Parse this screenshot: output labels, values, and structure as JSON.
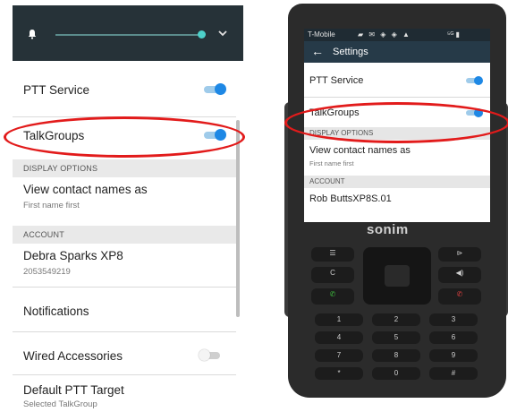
{
  "left_panel": {
    "settings": [
      {
        "title": "PTT Service",
        "toggle": "on"
      },
      {
        "title": "TalkGroups",
        "toggle": "on"
      }
    ],
    "section_display": "DISPLAY OPTIONS",
    "view_contact": {
      "title": "View contact names as",
      "subtitle": "First name first"
    },
    "section_account": "ACCOUNT",
    "account": {
      "name": "Debra Sparks XP8",
      "number": "2053549219"
    },
    "notifications": "Notifications",
    "wired_accessories": {
      "title": "Wired Accessories",
      "toggle": "off"
    },
    "default_ptt": {
      "title": "Default PTT Target",
      "subtitle": "Selected TalkGroup"
    }
  },
  "right_panel": {
    "status_carrier": "T-Mobile",
    "status_icons": "▰ ✉ ◈ ◈ ▲",
    "status_right": "⁵ᴳ ▮",
    "appbar_title": "Settings",
    "items": [
      {
        "title": "PTT Service",
        "toggle": "on"
      },
      {
        "title": "TalkGroups",
        "toggle": "on"
      }
    ],
    "section_display": "DISPLAY OPTIONS",
    "view_contact": {
      "title": "View contact names as",
      "subtitle": "First name first"
    },
    "section_account": "ACCOUNT",
    "account_name": "Rob ButtsXP8S.01",
    "brand": "sonim"
  },
  "colors": {
    "highlight": "#e21b1b",
    "toggle_on": "#1e88e5",
    "topbar": "#263238",
    "slider_accent": "#4dd0c9"
  },
  "icons": [
    "bell-icon",
    "chevron-down-icon",
    "back-arrow-icon"
  ]
}
